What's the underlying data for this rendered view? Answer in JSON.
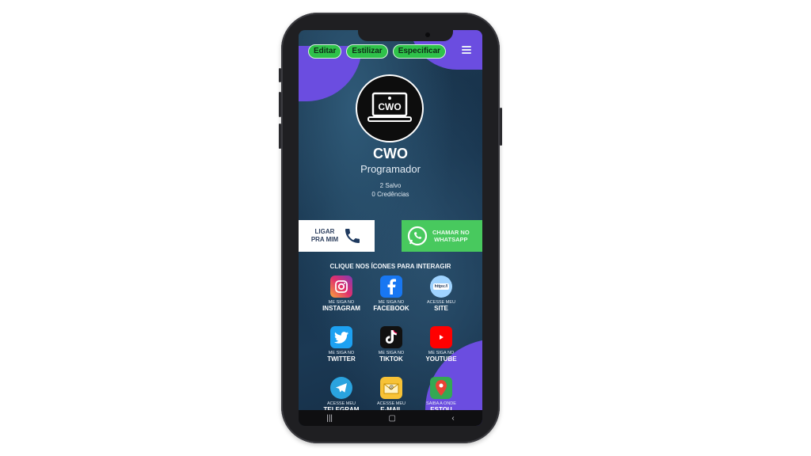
{
  "toolbar": {
    "buttons": [
      {
        "label": "Editar"
      },
      {
        "label": "Estilizar"
      },
      {
        "label": "Especificar"
      }
    ]
  },
  "profile": {
    "logo_text": "CWO",
    "name": "CWO",
    "role": "Programador",
    "saved": "2 Salvo",
    "credentials": "0 Credências"
  },
  "actions": {
    "call_line1": "LIGAR",
    "call_line2": "PRA MIM",
    "whatsapp_line1": "CHAMAR NO",
    "whatsapp_line2": "WHATSAPP"
  },
  "hint": "CLIQUE NOS ÍCONES PARA INTERAGIR",
  "icons": [
    {
      "small": "ME SIGA NO",
      "big": "INSTAGRAM",
      "icon": "instagram-icon"
    },
    {
      "small": "ME SIGA NO",
      "big": "FACEBOOK",
      "icon": "facebook-icon"
    },
    {
      "small": "ACESSE MEU",
      "big": "SITE",
      "icon": "website-icon",
      "badge": "https://"
    },
    {
      "small": "ME SIGA NO",
      "big": "TWITTER",
      "icon": "twitter-icon"
    },
    {
      "small": "ME SIGA NO",
      "big": "TIKTOK",
      "icon": "tiktok-icon"
    },
    {
      "small": "ME SIGA NO",
      "big": "YOUTUBE",
      "icon": "youtube-icon"
    },
    {
      "small": "ACESSE MEU",
      "big": "TELEGRAM",
      "icon": "telegram-icon"
    },
    {
      "small": "ACESSE MEU",
      "big": "E-MAIL",
      "icon": "email-icon"
    },
    {
      "small": "SAIBA A ONDE",
      "big": "ESTOU",
      "icon": "map-pin-icon"
    }
  ],
  "colors": {
    "accent_purple": "#6b4de0",
    "button_green": "#2fc24a",
    "whatsapp_green": "#48c95e"
  }
}
